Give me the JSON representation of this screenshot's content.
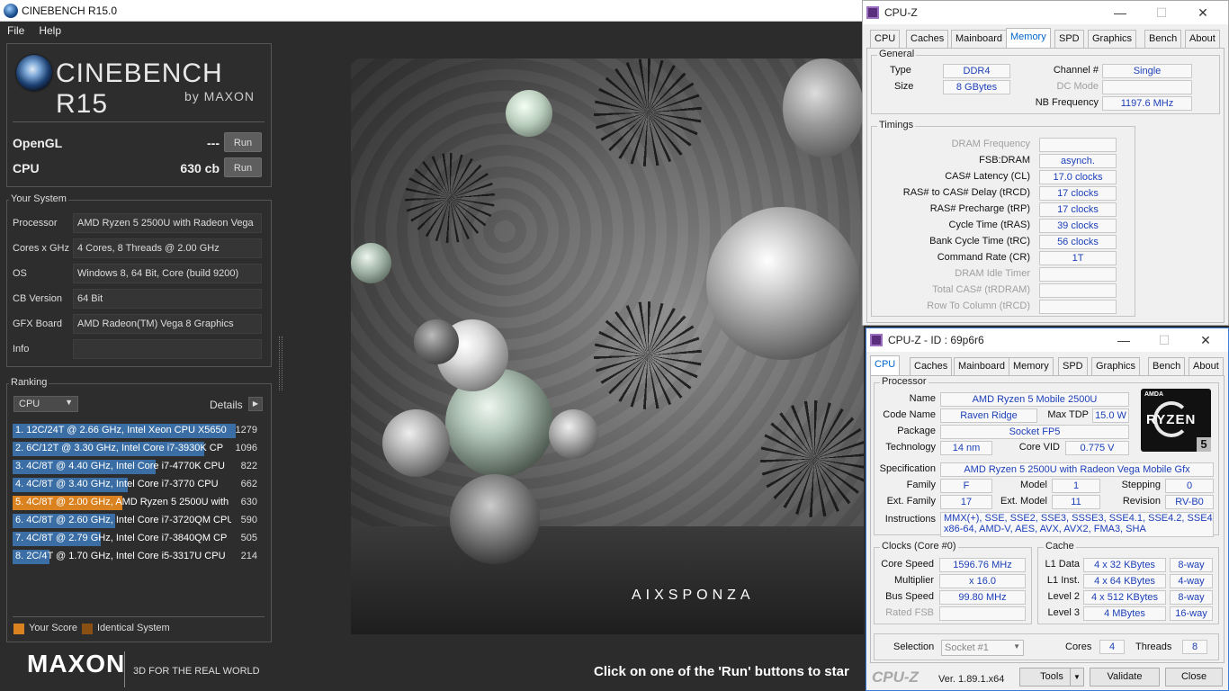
{
  "cinebench": {
    "window_title": "CINEBENCH R15.0",
    "menu": [
      "File",
      "Help"
    ],
    "logo_title": "CINEBENCH R15",
    "logo_sub": "by MAXON",
    "opengl_label": "OpenGL",
    "opengl_score": "---",
    "cpu_label": "CPU",
    "cpu_score": "630 cb",
    "run_label": "Run",
    "your_system_title": "Your System",
    "system": [
      {
        "label": "Processor",
        "value": "AMD Ryzen 5 2500U with Radeon Vega"
      },
      {
        "label": "Cores x GHz",
        "value": "4 Cores, 8 Threads @ 2.00 GHz"
      },
      {
        "label": "OS",
        "value": "Windows 8, 64 Bit, Core (build 9200)"
      },
      {
        "label": "CB Version",
        "value": "64 Bit"
      },
      {
        "label": "GFX Board",
        "value": "AMD Radeon(TM) Vega 8 Graphics"
      },
      {
        "label": "Info",
        "value": ""
      }
    ],
    "ranking_title": "Ranking",
    "ranking_select": "CPU",
    "details_label": "Details",
    "ranking": [
      {
        "text": "1. 12C/24T @ 2.66 GHz, Intel Xeon CPU X5650",
        "score": "1279",
        "value": 1279,
        "color": "#3a6ea5"
      },
      {
        "text": "2. 6C/12T @ 3.30 GHz,  Intel Core i7-3930K CP",
        "score": "1096",
        "value": 1096,
        "color": "#3a6ea5"
      },
      {
        "text": "3. 4C/8T @ 4.40 GHz, Intel Core i7-4770K CPU",
        "score": "822",
        "value": 822,
        "color": "#3a6ea5"
      },
      {
        "text": "4. 4C/8T @ 3.40 GHz,  Intel Core i7-3770 CPU",
        "score": "662",
        "value": 662,
        "color": "#3a6ea5"
      },
      {
        "text": "5. 4C/8T @ 2.00 GHz, AMD Ryzen 5 2500U with",
        "score": "630",
        "value": 630,
        "color": "#d9821f"
      },
      {
        "text": "6. 4C/8T @ 2.60 GHz, Intel Core i7-3720QM CPU",
        "score": "590",
        "value": 590,
        "color": "#3a6ea5"
      },
      {
        "text": "7. 4C/8T @ 2.79 GHz,  Intel Core i7-3840QM CP",
        "score": "505",
        "value": 505,
        "color": "#3a6ea5"
      },
      {
        "text": "8. 2C/4T @ 1.70 GHz,  Intel Core i5-3317U CPU",
        "score": "214",
        "value": 214,
        "color": "#3a6ea5"
      }
    ],
    "legend_your_score": "Your Score",
    "legend_identical": "Identical System",
    "your_score_color": "#d9821f",
    "identical_color": "#8a4f12",
    "maxon_logo": "MAXON",
    "tagline": "3D FOR THE REAL WORLD",
    "status_text": "Click on one of the 'Run' buttons to star",
    "render_watermark": "AIXSPONZA"
  },
  "cpuz_memory": {
    "title": "CPU-Z",
    "tabs": [
      "CPU",
      "Caches",
      "Mainboard",
      "Memory",
      "SPD",
      "Graphics",
      "Bench",
      "About"
    ],
    "active_tab": "Memory",
    "general_title": "General",
    "type_label": "Type",
    "type_value": "DDR4",
    "size_label": "Size",
    "size_value": "8 GBytes",
    "channel_label": "Channel #",
    "channel_value": "Single",
    "dc_label": "DC Mode",
    "dc_value": "",
    "nb_label": "NB Frequency",
    "nb_value": "1197.6 MHz",
    "timings_title": "Timings",
    "timings": [
      {
        "label": "DRAM Frequency",
        "value": "",
        "disabled": true
      },
      {
        "label": "FSB:DRAM",
        "value": "asynch.",
        "disabled": false
      },
      {
        "label": "CAS# Latency (CL)",
        "value": "17.0 clocks",
        "disabled": false
      },
      {
        "label": "RAS# to CAS# Delay (tRCD)",
        "value": "17 clocks",
        "disabled": false
      },
      {
        "label": "RAS# Precharge (tRP)",
        "value": "17 clocks",
        "disabled": false
      },
      {
        "label": "Cycle Time (tRAS)",
        "value": "39 clocks",
        "disabled": false
      },
      {
        "label": "Bank Cycle Time (tRC)",
        "value": "56 clocks",
        "disabled": false
      },
      {
        "label": "Command Rate (CR)",
        "value": "1T",
        "disabled": false
      },
      {
        "label": "DRAM Idle Timer",
        "value": "",
        "disabled": true
      },
      {
        "label": "Total CAS# (tRDRAM)",
        "value": "",
        "disabled": true
      },
      {
        "label": "Row To Column (tRCD)",
        "value": "",
        "disabled": true
      }
    ]
  },
  "cpuz_cpu": {
    "title": "CPU-Z - ID : 69p6r6",
    "tabs": [
      "CPU",
      "Caches",
      "Mainboard",
      "Memory",
      "SPD",
      "Graphics",
      "Bench",
      "About"
    ],
    "active_tab": "CPU",
    "processor_title": "Processor",
    "name_label": "Name",
    "name_value": "AMD Ryzen 5 Mobile 2500U",
    "codename_label": "Code Name",
    "codename_value": "Raven Ridge",
    "maxtdp_label": "Max TDP",
    "maxtdp_value": "15.0 W",
    "package_label": "Package",
    "package_value": "Socket FP5",
    "tech_label": "Technology",
    "tech_value": "14 nm",
    "corevid_label": "Core VID",
    "corevid_value": "0.775 V",
    "spec_label": "Specification",
    "spec_value": "AMD Ryzen 5 2500U with Radeon Vega Mobile Gfx",
    "family_label": "Family",
    "family_value": "F",
    "model_label": "Model",
    "model_value": "1",
    "stepping_label": "Stepping",
    "stepping_value": "0",
    "extfamily_label": "Ext. Family",
    "extfamily_value": "17",
    "extmodel_label": "Ext. Model",
    "extmodel_value": "11",
    "revision_label": "Revision",
    "revision_value": "RV-B0",
    "instr_label": "Instructions",
    "instr_value1": "MMX(+), SSE, SSE2, SSE3, SSSE3, SSE4.1, SSE4.2, SSE4A,",
    "instr_value2": "x86-64, AMD-V, AES, AVX, AVX2, FMA3, SHA",
    "logo_brand": "AMDA",
    "logo_ryzen": "RYZEN",
    "logo_num": "5",
    "clocks_title": "Clocks (Core #0)",
    "corespeed_label": "Core Speed",
    "corespeed_value": "1596.76 MHz",
    "multiplier_label": "Multiplier",
    "multiplier_value": "x 16.0",
    "busspeed_label": "Bus Speed",
    "busspeed_value": "99.80 MHz",
    "ratedfsb_label": "Rated FSB",
    "ratedfsb_value": "",
    "cache_title": "Cache",
    "cache": [
      {
        "label": "L1 Data",
        "size": "4 x 32 KBytes",
        "way": "8-way"
      },
      {
        "label": "L1 Inst.",
        "size": "4 x 64 KBytes",
        "way": "4-way"
      },
      {
        "label": "Level 2",
        "size": "4 x 512 KBytes",
        "way": "8-way"
      },
      {
        "label": "Level 3",
        "size": "4 MBytes",
        "way": "16-way"
      }
    ],
    "selection_label": "Selection",
    "selection_value": "Socket #1",
    "cores_label": "Cores",
    "cores_value": "4",
    "threads_label": "Threads",
    "threads_value": "8",
    "brand": "CPU-Z",
    "version": "Ver. 1.89.1.x64",
    "tools_label": "Tools",
    "validate_label": "Validate",
    "close_label": "Close"
  }
}
